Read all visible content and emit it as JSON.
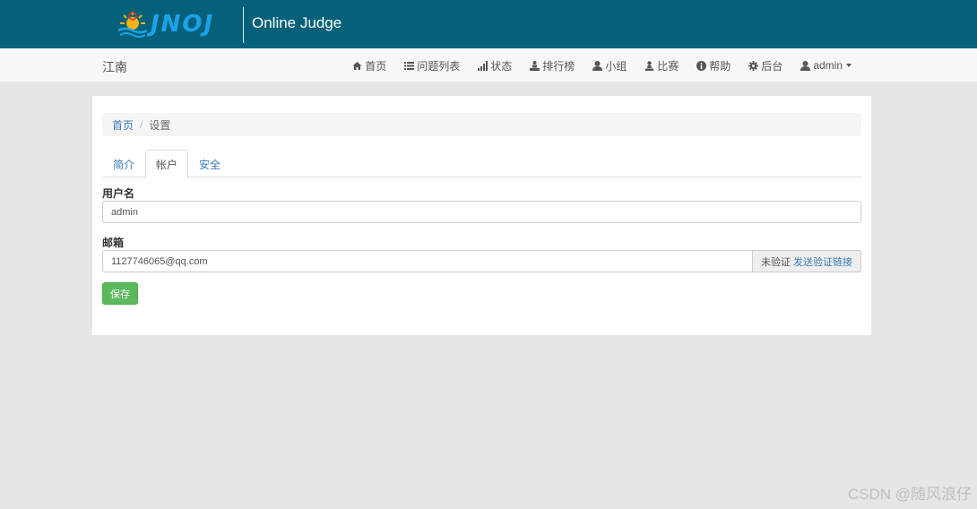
{
  "header": {
    "logo_text": "JNOJ",
    "site_title": "Online Judge"
  },
  "navbar": {
    "brand": "江南",
    "items": [
      {
        "label": "首页",
        "icon": "home-icon"
      },
      {
        "label": "问题列表",
        "icon": "list-icon"
      },
      {
        "label": "状态",
        "icon": "signal-icon"
      },
      {
        "label": "排行榜",
        "icon": "podium-icon"
      },
      {
        "label": "小组",
        "icon": "user-icon"
      },
      {
        "label": "比赛",
        "icon": "pawn-icon"
      },
      {
        "label": "帮助",
        "icon": "info-icon"
      },
      {
        "label": "后台",
        "icon": "gear-icon"
      }
    ],
    "user": {
      "label": "admin",
      "icon": "user-icon"
    }
  },
  "breadcrumb": {
    "home": "首页",
    "separator": "/",
    "current": "设置"
  },
  "tabs": [
    {
      "label": "简介",
      "active": false
    },
    {
      "label": "帐户",
      "active": true
    },
    {
      "label": "安全",
      "active": false
    }
  ],
  "form": {
    "username_label": "用户名",
    "username_value": "admin",
    "email_label": "邮箱",
    "email_value": "1127746065@qq.com",
    "verify_status": "未验证",
    "verify_link": "发送验证链接",
    "save_label": "保存"
  },
  "watermark": "CSDN @随风浪仔",
  "colors": {
    "topbar": "#05617a",
    "logo": "#1aa3e8",
    "link": "#3a7ab8",
    "save_button": "#5cb85c"
  }
}
